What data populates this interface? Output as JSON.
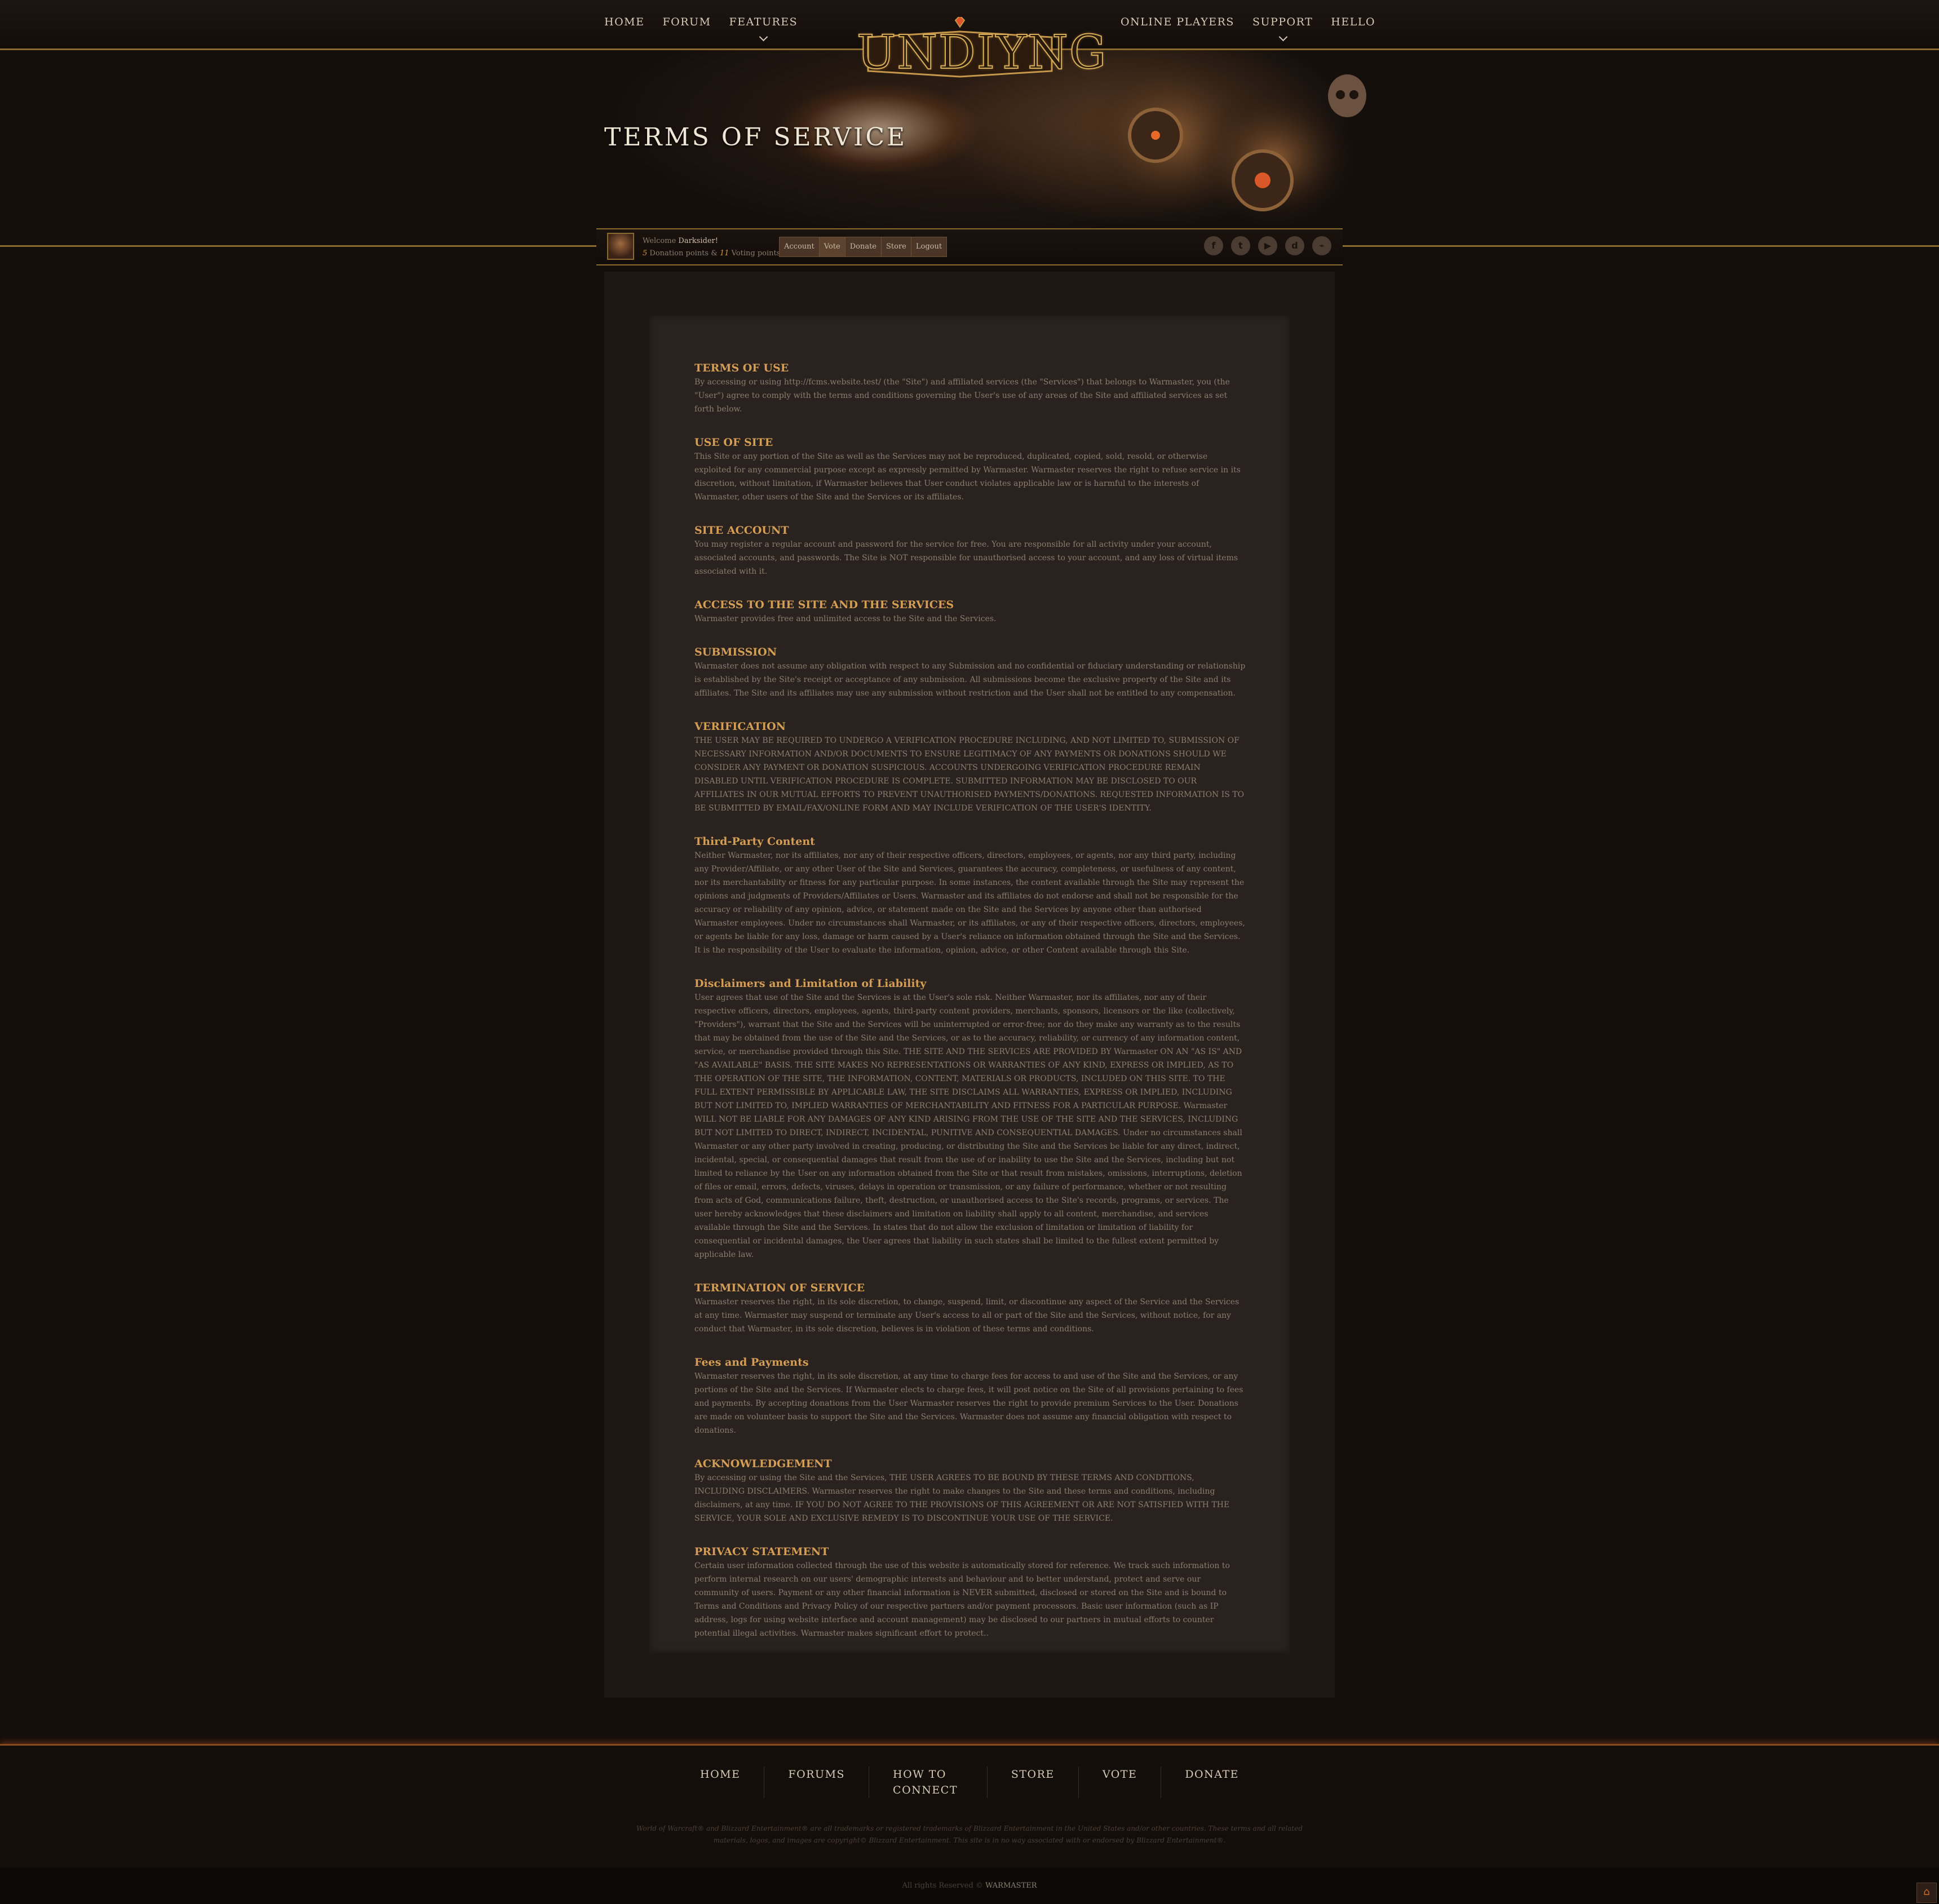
{
  "nav": {
    "left": [
      {
        "label": "HOME"
      },
      {
        "label": "FORUM"
      },
      {
        "label": "FEATURES",
        "dropdown": true
      }
    ],
    "right": [
      {
        "label": "ONLINE PLAYERS"
      },
      {
        "label": "SUPPORT",
        "dropdown": true
      },
      {
        "label": "HELLO"
      }
    ]
  },
  "logo": {
    "text": "UNDIYNG"
  },
  "page_title": "TERMS OF SERVICE",
  "user": {
    "welcome_prefix": "Welcome",
    "name": "Darksider!",
    "donation_points": "5",
    "donation_label": "Donation points &",
    "voting_points": "11",
    "voting_label": "Voting points",
    "menu": [
      "Account",
      "Vote",
      "Donate",
      "Store",
      "Logout"
    ],
    "active_menu": "Vote"
  },
  "social": [
    {
      "icon": "facebook-icon",
      "glyph": "f"
    },
    {
      "icon": "twitter-icon",
      "glyph": "t"
    },
    {
      "icon": "youtube-icon",
      "glyph": "▶"
    },
    {
      "icon": "discord-icon",
      "glyph": "d"
    },
    {
      "icon": "rss-icon",
      "glyph": "⌁"
    }
  ],
  "sections": [
    {
      "title": "TERMS OF USE",
      "body": "By accessing or using http://fcms.website.test/ (the \"Site\") and affiliated services (the \"Services\") that belongs to Warmaster, you (the \"User\") agree to comply with the terms and conditions governing the User's use of any areas of the Site and affiliated services as set forth below."
    },
    {
      "title": "USE OF SITE",
      "body": "This Site or any portion of the Site as well as the Services may not be reproduced, duplicated, copied, sold, resold, or otherwise exploited for any commercial purpose except as expressly permitted by Warmaster. Warmaster reserves the right to refuse service in its discretion, without limitation, if Warmaster believes that User conduct violates applicable law or is harmful to the interests of Warmaster, other users of the Site and the Services or its affiliates."
    },
    {
      "title": "SITE ACCOUNT",
      "body": "You may register a regular account and password for the service for free. You are responsible for all activity under your account, associated accounts, and passwords. The Site is NOT responsible for unauthorised access to your account, and any loss of virtual items associated with it."
    },
    {
      "title": "ACCESS TO THE SITE AND THE SERVICES",
      "body": "Warmaster provides free and unlimited access to the Site and the Services."
    },
    {
      "title": "SUBMISSION",
      "body": "Warmaster does not assume any obligation with respect to any Submission and no confidential or fiduciary understanding or relationship is established by the Site's receipt or acceptance of any submission. All submissions become the exclusive property of the Site and its affiliates. The Site and its affiliates may use any submission without restriction and the User shall not be entitled to any compensation."
    },
    {
      "title": "VERIFICATION",
      "body": "THE USER MAY BE REQUIRED TO UNDERGO A VERIFICATION PROCEDURE INCLUDING, AND NOT LIMITED TO, SUBMISSION OF NECESSARY INFORMATION AND/OR DOCUMENTS TO ENSURE LEGITIMACY OF ANY PAYMENTS OR DONATIONS SHOULD WE CONSIDER ANY PAYMENT OR DONATION SUSPICIOUS. ACCOUNTS UNDERGOING VERIFICATION PROCEDURE REMAIN DISABLED UNTIL VERIFICATION PROCEDURE IS COMPLETE. SUBMITTED INFORMATION MAY BE DISCLOSED TO OUR AFFILIATES IN OUR MUTUAL EFFORTS TO PREVENT UNAUTHORISED PAYMENTS/DONATIONS. REQUESTED INFORMATION IS TO BE SUBMITTED BY EMAIL/FAX/ONLINE FORM AND MAY INCLUDE VERIFICATION OF THE USER'S IDENTITY."
    },
    {
      "title": "Third-Party Content",
      "body": "Neither Warmaster, nor its affiliates, nor any of their respective officers, directors, employees, or agents, nor any third party, including any Provider/Affiliate, or any other User of the Site and Services, guarantees the accuracy, completeness, or usefulness of any content, nor its merchantability or fitness for any particular purpose. In some instances, the content available through the Site may represent the opinions and judgments of Providers/Affiliates or Users. Warmaster and its affiliates do not endorse and shall not be responsible for the accuracy or reliability of any opinion, advice, or statement made on the Site and the Services by anyone other than authorised Warmaster employees. Under no circumstances shall Warmaster, or its affiliates, or any of their respective officers, directors, employees, or agents be liable for any loss, damage or harm caused by a User's reliance on information obtained through the Site and the Services. It is the responsibility of the User to evaluate the information, opinion, advice, or other Content available through this Site."
    },
    {
      "title": "Disclaimers and Limitation of Liability",
      "body": "User agrees that use of the Site and the Services is at the User's sole risk. Neither Warmaster, nor its affiliates, nor any of their respective officers, directors, employees, agents, third-party content providers, merchants, sponsors, licensors or the like (collectively, \"Providers\"), warrant that the Site and the Services will be uninterrupted or error-free; nor do they make any warranty as to the results that may be obtained from the use of the Site and the Services, or as to the accuracy, reliability, or currency of any information content, service, or merchandise provided through this Site. THE SITE AND THE SERVICES ARE PROVIDED BY Warmaster ON AN \"AS IS\" AND \"AS AVAILABLE\" BASIS. THE SITE MAKES NO REPRESENTATIONS OR WARRANTIES OF ANY KIND, EXPRESS OR IMPLIED, AS TO THE OPERATION OF THE SITE, THE INFORMATION, CONTENT, MATERIALS OR PRODUCTS, INCLUDED ON THIS SITE. TO THE FULL EXTENT PERMISSIBLE BY APPLICABLE LAW, THE SITE DISCLAIMS ALL WARRANTIES, EXPRESS OR IMPLIED, INCLUDING BUT NOT LIMITED TO, IMPLIED WARRANTIES OF MERCHANTABILITY AND FITNESS FOR A PARTICULAR PURPOSE. Warmaster WILL NOT BE LIABLE FOR ANY DAMAGES OF ANY KIND ARISING FROM THE USE OF THE SITE AND THE SERVICES, INCLUDING BUT NOT LIMITED TO DIRECT, INDIRECT, INCIDENTAL, PUNITIVE AND CONSEQUENTIAL DAMAGES. Under no circumstances shall Warmaster or any other party involved in creating, producing, or distributing the Site and the Services be liable for any direct, indirect, incidental, special, or consequential damages that result from the use of or inability to use the Site and the Services, including but not limited to reliance by the User on any information obtained from the Site or that result from mistakes, omissions, interruptions, deletion of files or email, errors, defects, viruses, delays in operation or transmission, or any failure of performance, whether or not resulting from acts of God, communications failure, theft, destruction, or unauthorised access to the Site's records, programs, or services. The user hereby acknowledges that these disclaimers and limitation on liability shall apply to all content, merchandise, and services available through the Site and the Services. In states that do not allow the exclusion of limitation or limitation of liability for consequential or incidental damages, the User agrees that liability in such states shall be limited to the fullest extent permitted by applicable law."
    },
    {
      "title": "TERMINATION OF SERVICE",
      "body": "Warmaster reserves the right, in its sole discretion, to change, suspend, limit, or discontinue any aspect of the Service and the Services at any time. Warmaster may suspend or terminate any User's access to all or part of the Site and the Services, without notice, for any conduct that Warmaster, in its sole discretion, believes is in violation of these terms and conditions."
    },
    {
      "title": "Fees and Payments",
      "body": "Warmaster reserves the right, in its sole discretion, at any time to charge fees for access to and use of the Site and the Services, or any portions of the Site and the Services. If Warmaster elects to charge fees, it will post notice on the Site of all provisions pertaining to fees and payments. By accepting donations from the User Warmaster reserves the right to provide premium Services to the User. Donations are made on volunteer basis to support the Site and the Services. Warmaster does not assume any financial obligation with respect to donations."
    },
    {
      "title": "ACKNOWLEDGEMENT",
      "body": "By accessing or using the Site and the Services, THE USER AGREES TO BE BOUND BY THESE TERMS AND CONDITIONS, INCLUDING DISCLAIMERS. Warmaster reserves the right to make changes to the Site and these terms and conditions, including disclaimers, at any time. IF YOU DO NOT AGREE TO THE PROVISIONS OF THIS AGREEMENT OR ARE NOT SATISFIED WITH THE SERVICE, YOUR SOLE AND EXCLUSIVE REMEDY IS TO DISCONTINUE YOUR USE OF THE SERVICE."
    },
    {
      "title": "PRIVACY STATEMENT",
      "body": "Certain user information collected through the use of this website is automatically stored for reference. We track such information to perform internal research on our users' demographic interests and behaviour and to better understand, protect and serve our community of users. Payment or any other financial information is NEVER submitted, disclosed or stored on the Site and is bound to Terms and Conditions and Privacy Policy of our respective partners and/or payment processors. Basic user information (such as IP address, logs for using website interface and account management) may be disclosed to our partners in mutual efforts to counter potential illegal activities. Warmaster makes significant effort to protect.."
    }
  ],
  "footer": {
    "nav": [
      "HOME",
      "FORUMS",
      "HOW TO CONNECT",
      "STORE",
      "VOTE",
      "DONATE"
    ],
    "disclaimer": "World of Warcraft® and Blizzard Entertainment® are all trademarks or registered trademarks of Blizzard Entertainment in the United States and/or other countries. These terms and all related materials, logos, and images are copyright© Blizzard Entertainment. This site is in no way associated with or endorsed by Blizzard Entertainment®.",
    "copyright_prefix": "All rights Reserved ©",
    "copyright_brand": "WARMASTER"
  },
  "colors": {
    "accent_gold": "#d49f55",
    "border_gold": "#8b6a2e",
    "background": "#140e0b"
  }
}
